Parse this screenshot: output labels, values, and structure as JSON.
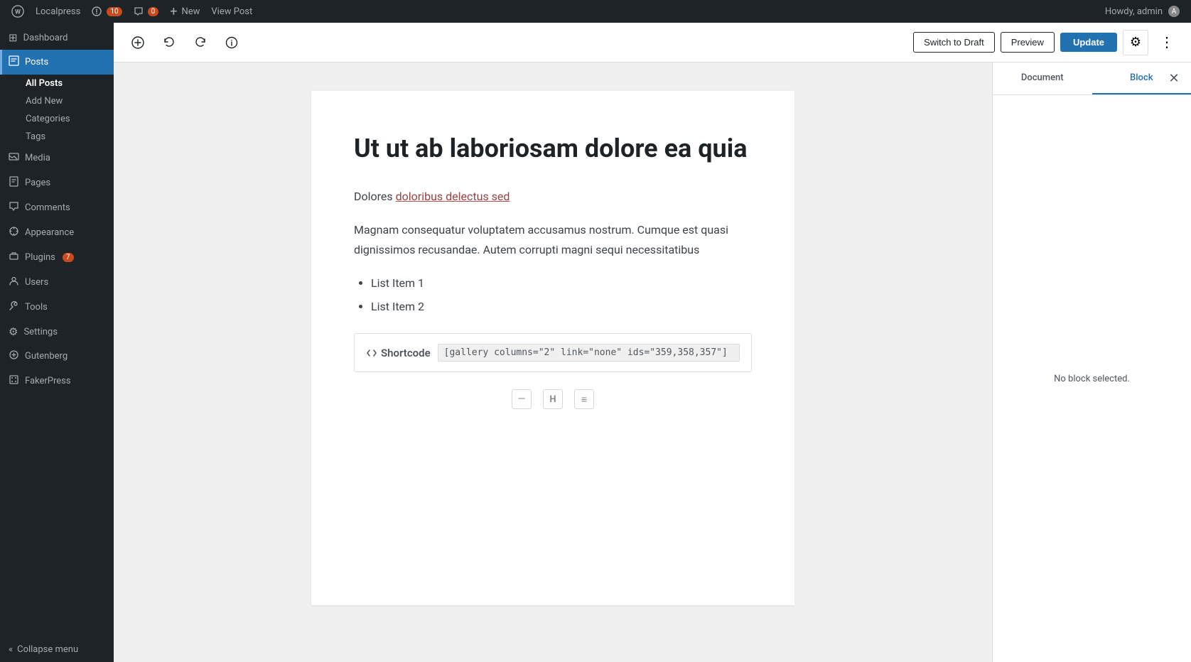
{
  "adminbar": {
    "site_name": "Localpress",
    "updates_count": "10",
    "comments_label": "0",
    "new_label": "New",
    "view_post_label": "View Post",
    "howdy_label": "Howdy, admin"
  },
  "sidebar": {
    "dashboard_label": "Dashboard",
    "posts_label": "Posts",
    "posts_submenu": {
      "all_posts": "All Posts",
      "add_new": "Add New",
      "categories": "Categories",
      "tags": "Tags"
    },
    "media_label": "Media",
    "pages_label": "Pages",
    "comments_label": "Comments",
    "appearance_label": "Appearance",
    "plugins_label": "Plugins",
    "plugins_badge": "7",
    "users_label": "Users",
    "tools_label": "Tools",
    "settings_label": "Settings",
    "gutenberg_label": "Gutenberg",
    "fakerpress_label": "FakerPress",
    "collapse_label": "Collapse menu"
  },
  "toolbar": {
    "switch_to_draft_label": "Switch to Draft",
    "preview_label": "Preview",
    "update_label": "Update"
  },
  "panel": {
    "document_tab": "Document",
    "block_tab": "Block",
    "no_block_msg": "No block selected."
  },
  "post": {
    "title": "Ut ut ab laboriosam dolore ea quia",
    "paragraph1_text": "Dolores ",
    "paragraph1_link": "doloribus delectus sed",
    "paragraph2": "Magnam consequatur voluptatem accusamus nostrum. Cumque est quasi dignissimos recusandae. Autem corrupti magni sequi necessitatibus",
    "list_item_1": "List Item 1",
    "list_item_2": "List Item 2",
    "shortcode_label": "Shortcode",
    "shortcode_value": "[gallery columns=\"2\" link=\"none\" ids=\"359,358,357\"]"
  },
  "colors": {
    "accent": "#2271b1",
    "adminbar_bg": "#1d2327",
    "sidebar_bg": "#1d2327",
    "active_tab": "#2271b1"
  },
  "icons": {
    "add_icon": "+",
    "undo_icon": "↩",
    "redo_icon": "↪",
    "info_icon": "ⓘ",
    "gear_icon": "⚙",
    "more_icon": "⋮",
    "close_icon": "✕",
    "bracket_icon": "<>",
    "dash_icon": "—",
    "heading_icon": "H",
    "list_icon": "≡",
    "dashboard_icon": "⊞",
    "posts_icon": "📝",
    "media_icon": "🖼",
    "pages_icon": "📄",
    "comments_icon": "💬",
    "appearance_icon": "🎨",
    "plugins_icon": "🔌",
    "users_icon": "👤",
    "tools_icon": "🔧",
    "settings_icon": "⚙",
    "collapse_icon": "«"
  }
}
